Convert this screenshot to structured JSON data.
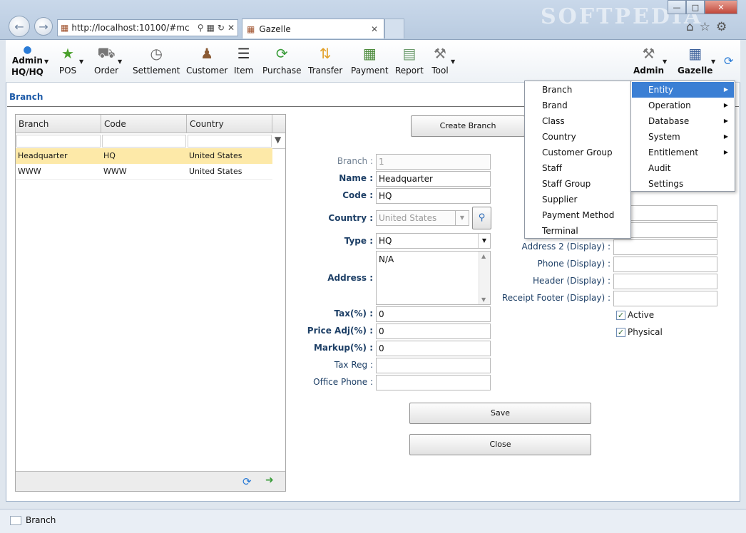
{
  "browser": {
    "address": "http://localhost:10100/#mc",
    "tab_title": "Gazelle",
    "watermark": "SOFTPEDIA"
  },
  "toolbar": {
    "user_line1": "Admin",
    "user_line2": "HQ/HQ",
    "items": [
      "POS",
      "Order",
      "Settlement",
      "Customer",
      "Item",
      "Purchase",
      "Transfer",
      "Payment",
      "Report",
      "Tool"
    ],
    "admin": "Admin",
    "gazelle": "Gazelle"
  },
  "page": {
    "title": "Branch"
  },
  "grid": {
    "columns": [
      "Branch",
      "Code",
      "Country"
    ],
    "rows": [
      [
        "Headquarter",
        "HQ",
        "United States"
      ],
      [
        "WWW",
        "WWW",
        "United States"
      ]
    ]
  },
  "form": {
    "create_button": "Create Branch",
    "branch_label": "Branch :",
    "branch_value": "1",
    "name_label": "Name :",
    "name_value": "Headquarter",
    "code_label": "Code :",
    "code_value": "HQ",
    "country_label": "Country :",
    "country_value": "United States",
    "type_label": "Type :",
    "type_value": "HQ",
    "address_label": "Address :",
    "address_value": "N/A",
    "tax_label": "Tax(%) :",
    "tax_value": "0",
    "price_adj_label": "Price Adj(%) :",
    "price_adj_value": "0",
    "markup_label": "Markup(%) :",
    "markup_value": "0",
    "tax_reg_label": "Tax Reg :",
    "office_phone_label": "Office Phone :",
    "address2_display_label": "Address 2 (Display) :",
    "phone_display_label": "Phone (Display) :",
    "header_display_label": "Header (Display) :",
    "receipt_footer_label": "Receipt Footer (Display) :",
    "active_label": "Active",
    "physical_label": "Physical",
    "save_button": "Save",
    "close_button": "Close"
  },
  "entity_menu": [
    "Branch",
    "Brand",
    "Class",
    "Country",
    "Customer Group",
    "Staff",
    "Staff Group",
    "Supplier",
    "Payment Method",
    "Terminal"
  ],
  "admin_menu": [
    "Entity",
    "Operation",
    "Database",
    "System",
    "Entitlement",
    "Audit",
    "Settings"
  ],
  "status_bar": {
    "text": "Branch"
  }
}
